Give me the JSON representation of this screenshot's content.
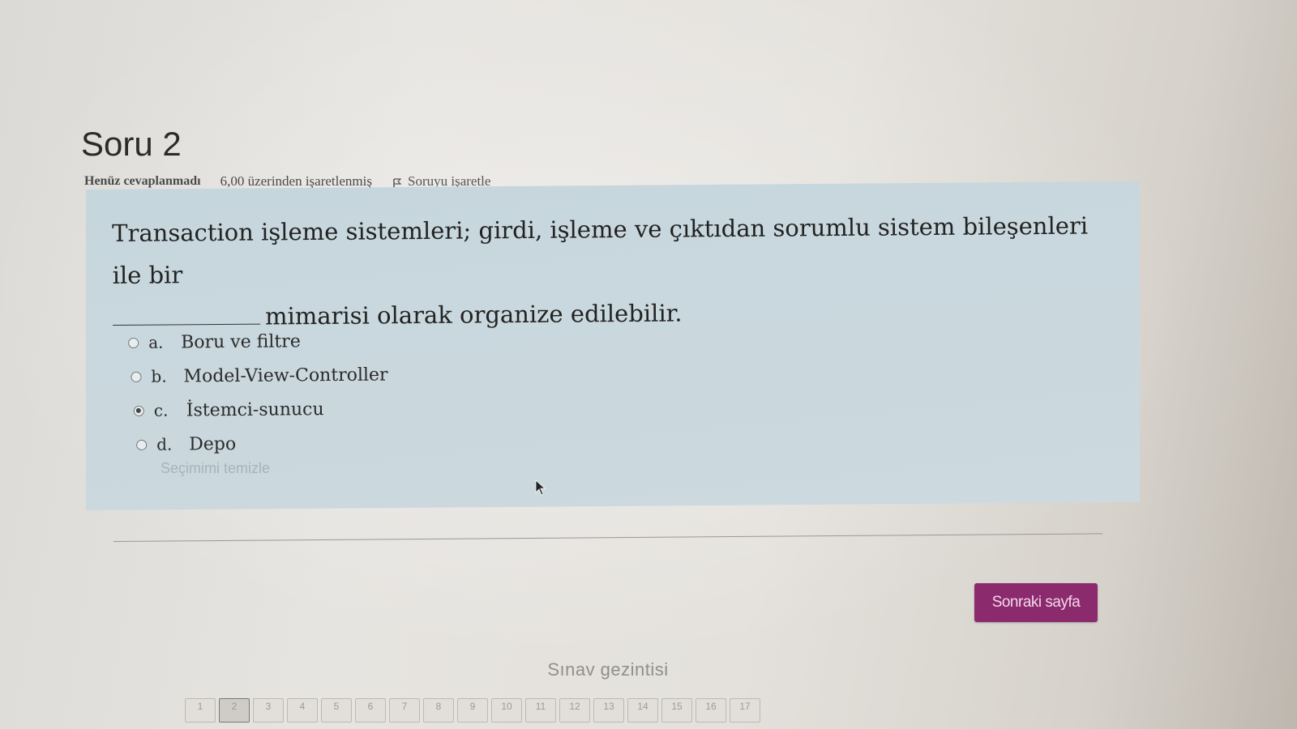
{
  "question": {
    "title": "Soru 2",
    "state": "Henüz cevaplanmadı",
    "grade": "6,00 üzerinden işaretlenmiş",
    "flag_label": "Soruyu işaretle",
    "text_line1": "Transaction işleme sistemleri; girdi, işleme ve çıktıdan sorumlu sistem bileşenleri ile bir",
    "text_line2": "mimarisi olarak organize edilebilir.",
    "answers": [
      {
        "letter": "a.",
        "label": "Boru ve filtre",
        "selected": false
      },
      {
        "letter": "b.",
        "label": "Model-View-Controller",
        "selected": false
      },
      {
        "letter": "c.",
        "label": "İstemci-sunucu",
        "selected": true
      },
      {
        "letter": "d.",
        "label": "Depo",
        "selected": false
      }
    ],
    "clear_choice": "Seçimimi temizle"
  },
  "footer": {
    "next_button": "Sonraki sayfa"
  },
  "quiz_nav": {
    "title": "Sınav gezintisi",
    "buttons": [
      "1",
      "2",
      "3",
      "4",
      "5",
      "6",
      "7",
      "8",
      "9",
      "10",
      "11",
      "12",
      "13",
      "14",
      "15",
      "16",
      "17"
    ],
    "current": "2"
  }
}
